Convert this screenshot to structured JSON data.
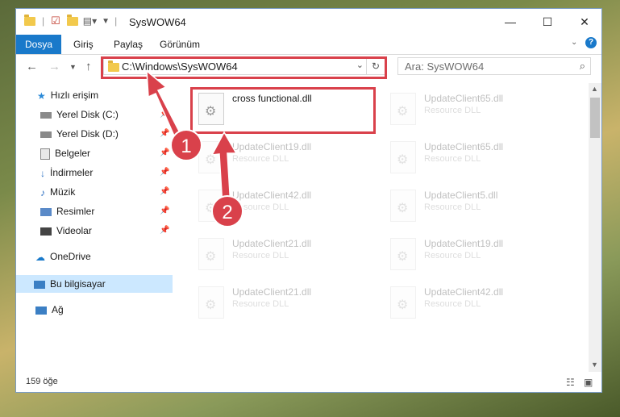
{
  "window": {
    "title": "SysWOW64"
  },
  "ribbon": {
    "tabs": [
      "Dosya",
      "Giriş",
      "Paylaş",
      "Görünüm"
    ]
  },
  "address": {
    "path": "C:\\Windows\\SysWOW64"
  },
  "search": {
    "placeholder": "Ara: SysWOW64"
  },
  "sidebar": {
    "items": [
      {
        "label": "Hızlı erişim",
        "icon": "star-icon",
        "pinned": false
      },
      {
        "label": "Yerel Disk (C:)",
        "icon": "drive-icon",
        "pinned": true
      },
      {
        "label": "Yerel Disk (D:)",
        "icon": "drive-icon",
        "pinned": true
      },
      {
        "label": "Belgeler",
        "icon": "documents-icon",
        "pinned": true
      },
      {
        "label": "İndirmeler",
        "icon": "download-icon",
        "pinned": true
      },
      {
        "label": "Müzik",
        "icon": "music-icon",
        "pinned": true
      },
      {
        "label": "Resimler",
        "icon": "pictures-icon",
        "pinned": true
      },
      {
        "label": "Videolar",
        "icon": "videos-icon",
        "pinned": true
      },
      {
        "label": "OneDrive",
        "icon": "cloud-icon",
        "pinned": false
      },
      {
        "label": "Bu bilgisayar",
        "icon": "computer-icon",
        "pinned": false
      },
      {
        "label": "Ağ",
        "icon": "network-icon",
        "pinned": false
      }
    ]
  },
  "files": [
    {
      "name": "cross functional.dll",
      "type": ""
    },
    {
      "name": "UpdateClient65.dll",
      "type": "Resource DLL"
    },
    {
      "name": "UpdateClient19.dll",
      "type": "Resource DLL"
    },
    {
      "name": "UpdateClient65.dll",
      "type": "Resource DLL"
    },
    {
      "name": "UpdateClient42.dll",
      "type": "Resource DLL"
    },
    {
      "name": "UpdateClient5.dll",
      "type": "Resource DLL"
    },
    {
      "name": "UpdateClient21.dll",
      "type": "Resource DLL"
    },
    {
      "name": "UpdateClient19.dll",
      "type": "Resource DLL"
    },
    {
      "name": "UpdateClient21.dll",
      "type": "Resource DLL"
    },
    {
      "name": "UpdateClient42.dll",
      "type": "Resource DLL"
    }
  ],
  "status": {
    "count": "159 öğe"
  },
  "annotations": {
    "step1": "1",
    "step2": "2",
    "color": "#d9414b"
  }
}
